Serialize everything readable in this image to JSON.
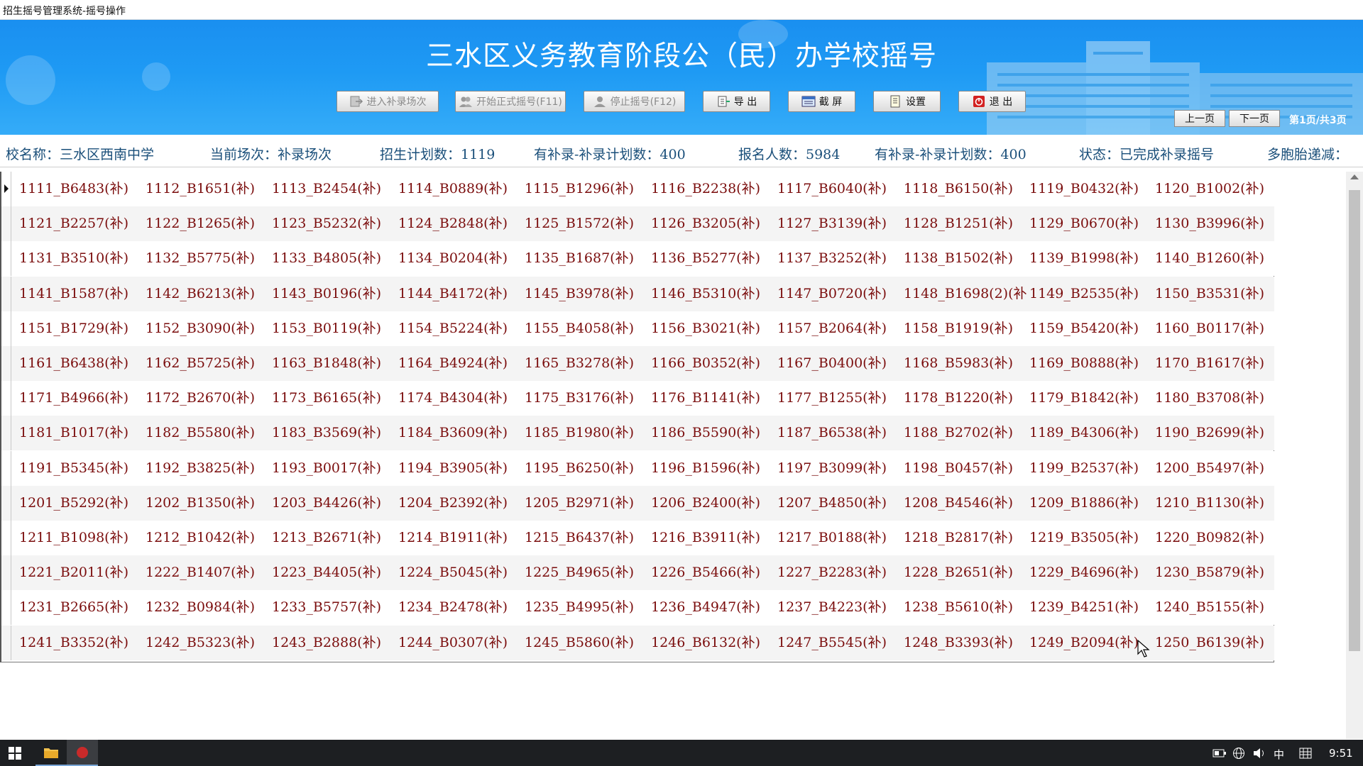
{
  "window": {
    "title": "招生摇号管理系统-摇号操作"
  },
  "banner": {
    "title": "三水区义务教育阶段公（民）办学校摇号"
  },
  "toolbar": {
    "enter_makeup": "进入补录场次",
    "start_formal": "开始正式摇号(F11)",
    "stop": "停止摇号(F12)",
    "export": "导 出",
    "screenshot": "截 屏",
    "settings": "设置",
    "exit": "退 出"
  },
  "pager": {
    "prev": "上一页",
    "next": "下一页",
    "info": "第1页/共3页"
  },
  "infobar": {
    "school": "校名称：三水区西南中学",
    "session": "当前场次：补录场次",
    "plan": "招生计划数：1119",
    "makeup_plan": "有补录-补录计划数：400",
    "applicants": "报名人数：5984",
    "makeup_plan2": "有补录-补录计划数：400",
    "status": "状态：已完成补录摇号",
    "twins": "多胞胎递减："
  },
  "grid": {
    "rows": [
      [
        "1111_B6483(补)",
        "1112_B1651(补)",
        "1113_B2454(补)",
        "1114_B0889(补)",
        "1115_B1296(补)",
        "1116_B2238(补)",
        "1117_B6040(补)",
        "1118_B6150(补)",
        "1119_B0432(补)",
        "1120_B1002(补)"
      ],
      [
        "1121_B2257(补)",
        "1122_B1265(补)",
        "1123_B5232(补)",
        "1124_B2848(补)",
        "1125_B1572(补)",
        "1126_B3205(补)",
        "1127_B3139(补)",
        "1128_B1251(补)",
        "1129_B0670(补)",
        "1130_B3996(补)"
      ],
      [
        "1131_B3510(补)",
        "1132_B5775(补)",
        "1133_B4805(补)",
        "1134_B0204(补)",
        "1135_B1687(补)",
        "1136_B5277(补)",
        "1137_B3252(补)",
        "1138_B1502(补)",
        "1139_B1998(补)",
        "1140_B1260(补)"
      ],
      [
        "1141_B1587(补)",
        "1142_B6213(补)",
        "1143_B0196(补)",
        "1144_B4172(补)",
        "1145_B3978(补)",
        "1146_B5310(补)",
        "1147_B0720(补)",
        "1148_B1698(2)(补",
        "1149_B2535(补)",
        "1150_B3531(补)"
      ],
      [
        "1151_B1729(补)",
        "1152_B3090(补)",
        "1153_B0119(补)",
        "1154_B5224(补)",
        "1155_B4058(补)",
        "1156_B3021(补)",
        "1157_B2064(补)",
        "1158_B1919(补)",
        "1159_B5420(补)",
        "1160_B0117(补)"
      ],
      [
        "1161_B6438(补)",
        "1162_B5725(补)",
        "1163_B1848(补)",
        "1164_B4924(补)",
        "1165_B3278(补)",
        "1166_B0352(补)",
        "1167_B0400(补)",
        "1168_B5983(补)",
        "1169_B0888(补)",
        "1170_B1617(补)"
      ],
      [
        "1171_B4966(补)",
        "1172_B2670(补)",
        "1173_B6165(补)",
        "1174_B4304(补)",
        "1175_B3176(补)",
        "1176_B1141(补)",
        "1177_B1255(补)",
        "1178_B1220(补)",
        "1179_B1842(补)",
        "1180_B3708(补)"
      ],
      [
        "1181_B1017(补)",
        "1182_B5580(补)",
        "1183_B3569(补)",
        "1184_B3609(补)",
        "1185_B1980(补)",
        "1186_B5590(补)",
        "1187_B6538(补)",
        "1188_B2702(补)",
        "1189_B4306(补)",
        "1190_B2699(补)"
      ],
      [
        "1191_B5345(补)",
        "1192_B3825(补)",
        "1193_B0017(补)",
        "1194_B3905(补)",
        "1195_B6250(补)",
        "1196_B1596(补)",
        "1197_B3099(补)",
        "1198_B0457(补)",
        "1199_B2537(补)",
        "1200_B5497(补)"
      ],
      [
        "1201_B5292(补)",
        "1202_B1350(补)",
        "1203_B4426(补)",
        "1204_B2392(补)",
        "1205_B2971(补)",
        "1206_B2400(补)",
        "1207_B4850(补)",
        "1208_B4546(补)",
        "1209_B1886(补)",
        "1210_B1130(补)"
      ],
      [
        "1211_B1098(补)",
        "1212_B1042(补)",
        "1213_B2671(补)",
        "1214_B1911(补)",
        "1215_B6437(补)",
        "1216_B3911(补)",
        "1217_B0188(补)",
        "1218_B2817(补)",
        "1219_B3505(补)",
        "1220_B0982(补)"
      ],
      [
        "1221_B2011(补)",
        "1222_B1407(补)",
        "1223_B4405(补)",
        "1224_B5045(补)",
        "1225_B4965(补)",
        "1226_B5466(补)",
        "1227_B2283(补)",
        "1228_B2651(补)",
        "1229_B4696(补)",
        "1230_B5879(补)"
      ],
      [
        "1231_B2665(补)",
        "1232_B0984(补)",
        "1233_B5757(补)",
        "1234_B2478(补)",
        "1235_B4995(补)",
        "1236_B4947(补)",
        "1237_B4223(补)",
        "1238_B5610(补)",
        "1239_B4251(补)",
        "1240_B5155(补)"
      ],
      [
        "1241_B3352(补)",
        "1242_B5323(补)",
        "1243_B2888(补)",
        "1244_B0307(补)",
        "1245_B5860(补)",
        "1246_B6132(补)",
        "1247_B5545(补)",
        "1248_B3393(补)",
        "1249_B2094(补)",
        "1250_B6139(补)"
      ]
    ]
  },
  "taskbar": {
    "ime": "中",
    "clock": "9:51"
  },
  "colors": {
    "banner": "#1e9af4",
    "cell_text": "#7a0c0c",
    "info_text": "#1a4f7a"
  }
}
